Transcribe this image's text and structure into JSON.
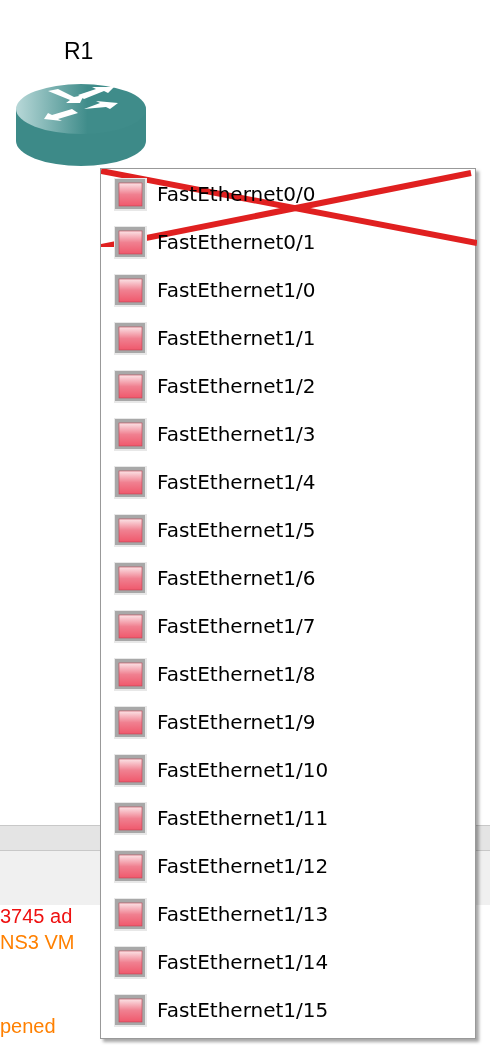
{
  "node": {
    "label": "R1"
  },
  "console": {
    "lines": [
      {
        "text": "3745 ad",
        "kind": "error"
      },
      {
        "text": "NS3 VM",
        "kind": "warning"
      },
      {
        "text": "pened",
        "kind": "warning"
      }
    ]
  },
  "menu": {
    "crossed_out": true,
    "items": [
      {
        "label": "FastEthernet0/0"
      },
      {
        "label": "FastEthernet0/1"
      },
      {
        "label": "FastEthernet1/0"
      },
      {
        "label": "FastEthernet1/1"
      },
      {
        "label": "FastEthernet1/2"
      },
      {
        "label": "FastEthernet1/3"
      },
      {
        "label": "FastEthernet1/4"
      },
      {
        "label": "FastEthernet1/5"
      },
      {
        "label": "FastEthernet1/6"
      },
      {
        "label": "FastEthernet1/7"
      },
      {
        "label": "FastEthernet1/8"
      },
      {
        "label": "FastEthernet1/9"
      },
      {
        "label": "FastEthernet1/10"
      },
      {
        "label": "FastEthernet1/11"
      },
      {
        "label": "FastEthernet1/12"
      },
      {
        "label": "FastEthernet1/13"
      },
      {
        "label": "FastEthernet1/14"
      },
      {
        "label": "FastEthernet1/15"
      }
    ]
  }
}
